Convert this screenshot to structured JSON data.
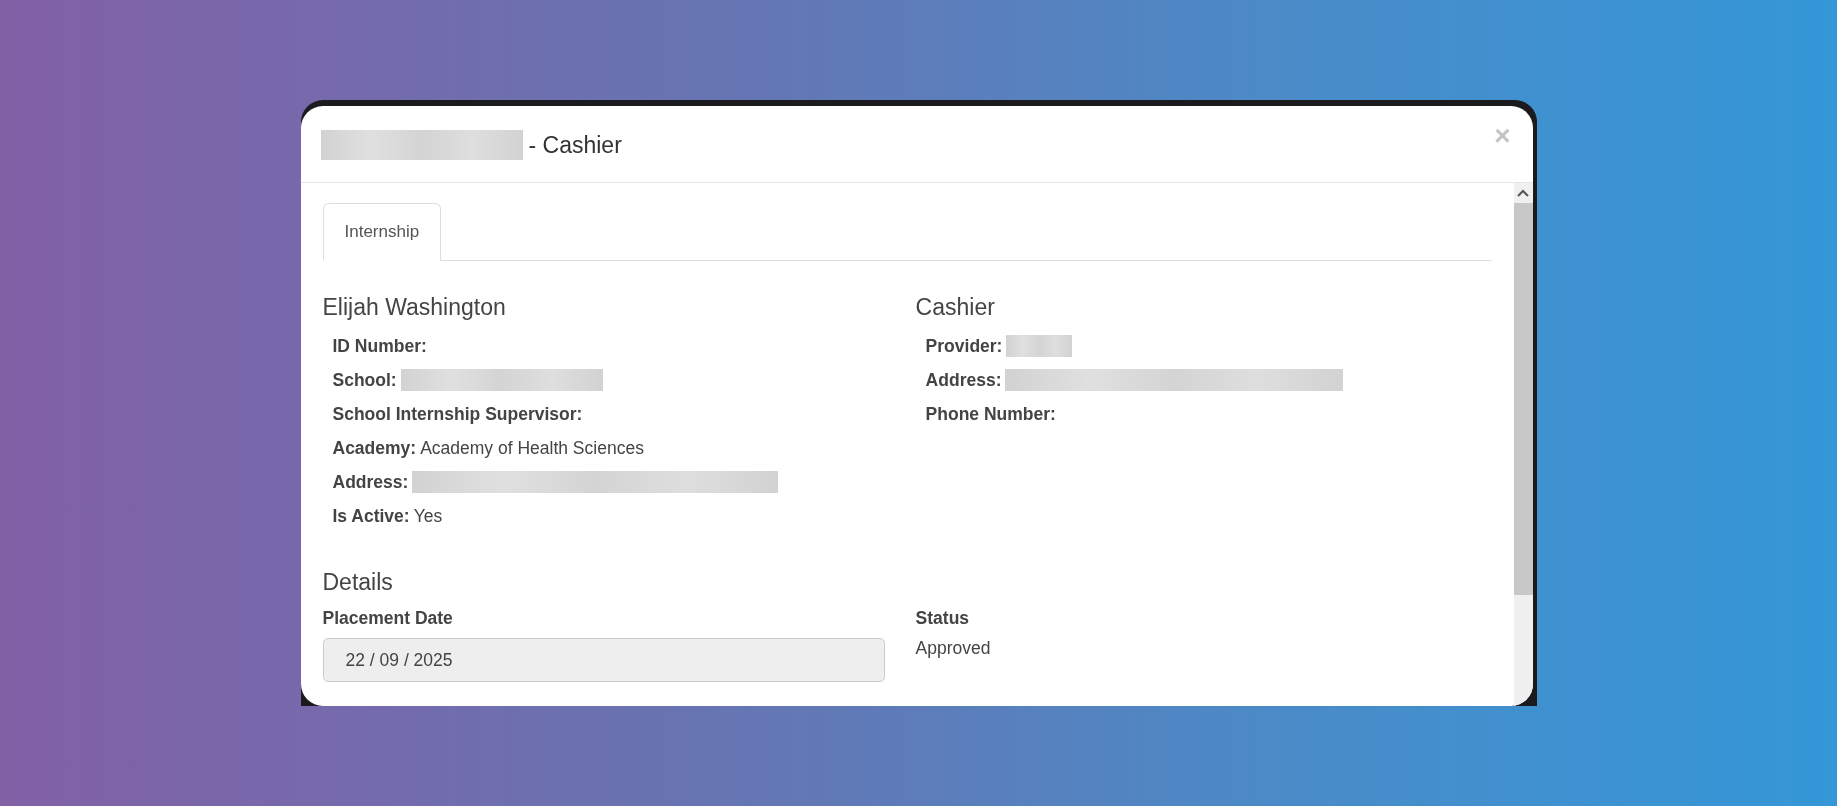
{
  "dialog": {
    "title": {
      "redacted_prefix": true,
      "text": "- Cashier"
    },
    "close": "×"
  },
  "tabs": [
    {
      "label": "Internship",
      "selected": true
    }
  ],
  "student": {
    "heading": "Elijah Washington",
    "fields": [
      {
        "label": "ID Number:",
        "redacted": false
      },
      {
        "label": "School:",
        "redacted": true
      },
      {
        "label": "School Internship Supervisor:",
        "redacted": false
      },
      {
        "label": "Academy:",
        "value": "Academy of Health Sciences",
        "redacted": false
      },
      {
        "label": "Address:",
        "redacted": true
      },
      {
        "label": "Is Active:",
        "value": "Yes",
        "redacted": false
      }
    ]
  },
  "position": {
    "heading": "Cashier",
    "fields": [
      {
        "label": "Provider:",
        "redacted": true
      },
      {
        "label": "Address:",
        "redacted": true
      },
      {
        "label": "Phone Number:",
        "redacted": false
      }
    ]
  },
  "details": {
    "heading": "Details",
    "placement_date": {
      "label": "Placement Date",
      "value": "22 / 09 / 2025"
    },
    "status": {
      "label": "Status",
      "value": "Approved"
    }
  }
}
